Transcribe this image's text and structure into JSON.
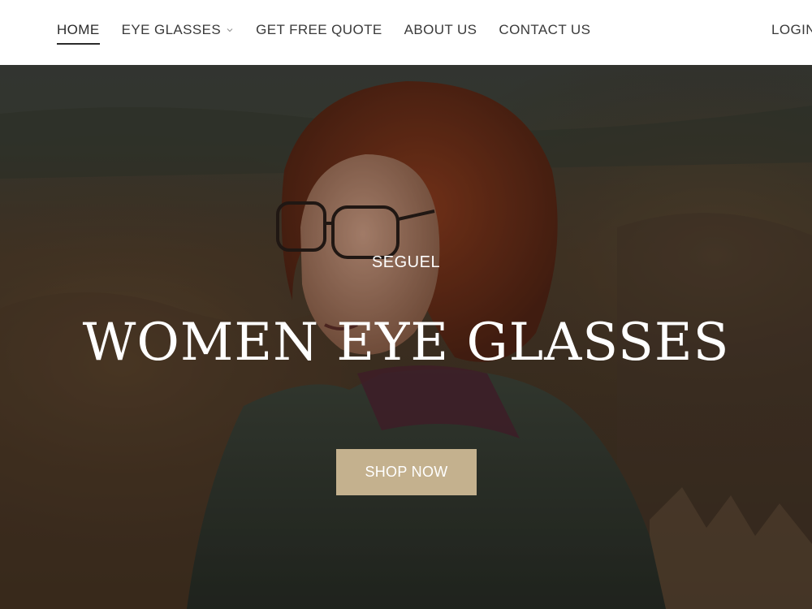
{
  "nav": {
    "items": [
      {
        "label": "HOME",
        "active": true
      },
      {
        "label": "EYE GLASSES",
        "has_dropdown": true
      },
      {
        "label": "GET FREE QUOTE"
      },
      {
        "label": "ABOUT US"
      },
      {
        "label": "CONTACT US"
      }
    ],
    "login_label": "LOGIN"
  },
  "hero": {
    "eyebrow": "SEGUEL",
    "headline": "WOMEN EYE GLASSES",
    "cta_label": "SHOP NOW"
  },
  "colors": {
    "header_bg": "#ffffff",
    "nav_text": "#3a3a3a",
    "cta_bg": "#c4b18e",
    "hero_text": "#ffffff"
  },
  "icons": {
    "dropdown": "chevron-down-icon"
  }
}
